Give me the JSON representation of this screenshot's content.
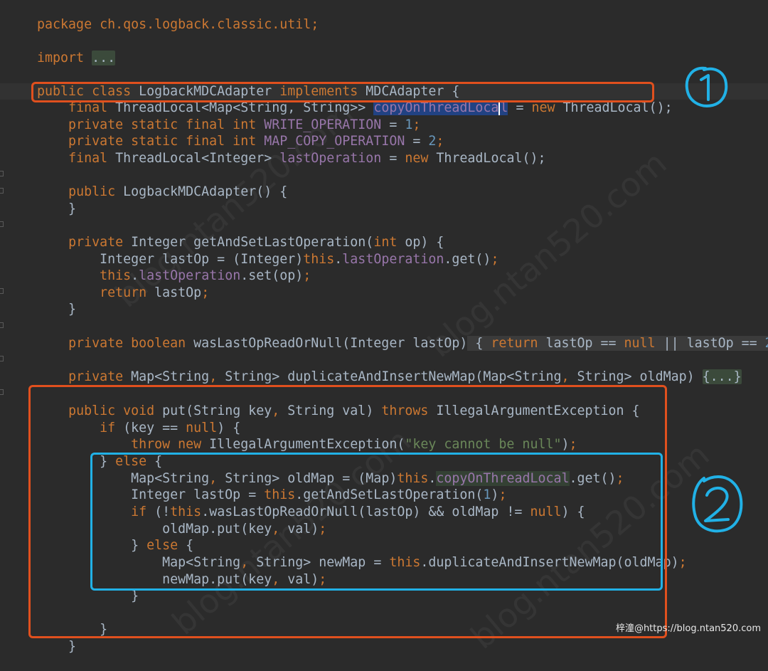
{
  "editor": {
    "lines": {
      "l1": {
        "a": "package ch.qos.logback.classic.util;"
      },
      "l2": {
        "a": "import",
        "b": " ",
        "c": "..."
      },
      "l3": {
        "a": "public class",
        "b": " LogbackMDCAdapter ",
        "c": "implements",
        "d": " MDCAdapter {"
      },
      "l4": {
        "a": "    ",
        "b": "final",
        "c": " ThreadLocal<Map<String, String>> ",
        "d": "copyOnThreadLoca",
        "e": "l",
        "f": " = ",
        "g": "new",
        "h": " ThreadLocal();"
      },
      "l5": {
        "a": "    private static final int",
        "b": " WRITE_OPERATION",
        "c": " = ",
        "d": "1",
        "e": ";"
      },
      "l6": {
        "a": "    private static final int",
        "b": " MAP_COPY_OPERATION",
        "c": " = ",
        "d": "2",
        "e": ";"
      },
      "l7": {
        "a": "    ",
        "b": "final",
        "c": " ThreadLocal<Integer> ",
        "d": "lastOperation",
        "e": " = ",
        "f": "new",
        "g": " ThreadLocal();"
      },
      "l8": {
        "a": "    ",
        "b": "public",
        "c": " LogbackMDCAdapter() {"
      },
      "l9": {
        "a": "    }"
      },
      "l10": {
        "a": "    ",
        "b": "private",
        "c": " Integer getAndSetLastOperation(",
        "d": "int",
        "e": " op) {"
      },
      "l11": {
        "a": "        Integer lastOp = (Integer)",
        "b": "this",
        "c": ".",
        "d": "lastOperation",
        "e": ".get()",
        "f": ";"
      },
      "l12": {
        "a": "        ",
        "b": "this",
        "c": ".",
        "d": "lastOperation",
        "e": ".set(op)",
        "f": ";"
      },
      "l13": {
        "a": "        ",
        "b": "return",
        "c": " lastOp",
        "d": ";"
      },
      "l14": {
        "a": "    }"
      },
      "l15": {
        "a": "    ",
        "b": "private boolean",
        "c": " wasLastOpReadOrNull(Integer lastOp)",
        "d": " { ",
        "e": "return",
        "f": " lastOp == ",
        "g": "null",
        "h": " || lastOp == ",
        "i": "2",
        "j": ";",
        "k": " }"
      },
      "l16": {
        "a": "    ",
        "b": "private",
        "c": " Map<String",
        "d": ",",
        "e": " String> duplicateAndInsertNewMap(Map<String",
        "f": ",",
        "g": " String> oldMap) ",
        "h": "{...}"
      },
      "l17": {
        "a": "    ",
        "b": "public void",
        "c": " put(String key",
        "d": ",",
        "e": " String val) ",
        "f": "throws",
        "g": " IllegalArgumentException {"
      },
      "l18": {
        "a": "        ",
        "b": "if",
        "c": " (key == ",
        "d": "null",
        "e": ") {"
      },
      "l19": {
        "a": "            ",
        "b": "throw new",
        "c": " IllegalArgumentException(",
        "d": "\"key cannot be null\"",
        "e": ")",
        "f": ";"
      },
      "l20": {
        "a": "        } ",
        "b": "else",
        "c": " {"
      },
      "l21": {
        "a": "            Map<String",
        "b": ",",
        "c": " String> oldMap = (Map)",
        "d": "this",
        "e": ".",
        "f": "copyOnThreadLocal",
        "g": ".get()",
        "h": ";"
      },
      "l22": {
        "a": "            Integer lastOp = ",
        "b": "this",
        "c": ".getAndSetLastOperation(",
        "d": "1",
        "e": ")",
        "f": ";"
      },
      "l23": {
        "a": "            ",
        "b": "if",
        "c": " (!",
        "d": "this",
        "e": ".wasLastOpReadOrNull(lastOp) && oldMap != ",
        "f": "null",
        "g": ") {"
      },
      "l24": {
        "a": "                oldMap.put(key",
        "b": ",",
        "c": " val)",
        "d": ";"
      },
      "l25": {
        "a": "            } ",
        "b": "else",
        "c": " {"
      },
      "l26": {
        "a": "                Map<String",
        "b": ",",
        "c": " String> newMap = ",
        "d": "this",
        "e": ".duplicateAndInsertNewMap(oldMap)",
        "f": ";"
      },
      "l27": {
        "a": "                newMap.put(key",
        "b": ",",
        "c": " val)",
        "d": ";"
      },
      "l28": {
        "a": "            }"
      },
      "l29": {
        "a": "        }"
      },
      "l30": {
        "a": "    }"
      }
    }
  },
  "annotations": {
    "marker_1": "①",
    "marker_2": "②"
  },
  "credit": "梓潼@https://blog.ntan520.com",
  "colors": {
    "background": "#2b2b2b",
    "keyword": "#cc7832",
    "number": "#6897bb",
    "string": "#6a8759",
    "field": "#9876aa",
    "default_text": "#a9b7c6",
    "orange_box": "#e0501e",
    "blue_box": "#21b1e6"
  }
}
